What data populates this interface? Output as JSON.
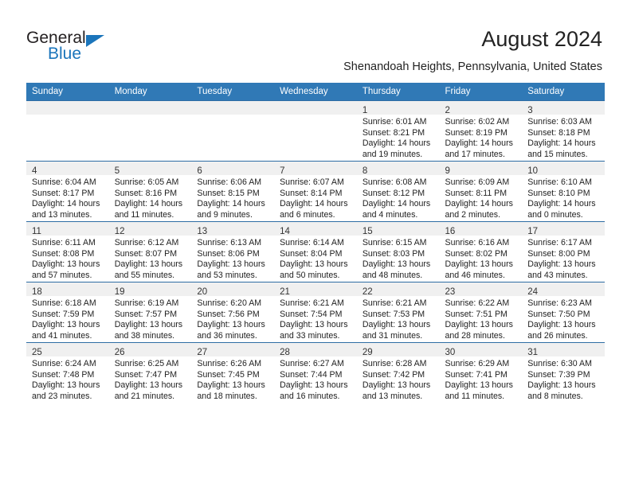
{
  "brand": {
    "name_part1": "General",
    "name_part2": "Blue",
    "triangle_color": "#1b75bb"
  },
  "header": {
    "title": "August 2024",
    "subtitle": "Shenandoah Heights, Pennsylvania, United States"
  },
  "theme": {
    "header_bg": "#3079b6",
    "row_separator": "#2e6da4",
    "daynum_strip_bg": "#f0f0f0",
    "text": "#222222"
  },
  "calendar": {
    "weekday_headers": [
      "Sunday",
      "Monday",
      "Tuesday",
      "Wednesday",
      "Thursday",
      "Friday",
      "Saturday"
    ],
    "weeks": [
      [
        {
          "day": "",
          "empty": true,
          "sunrise": "",
          "sunset": "",
          "daylight_line1": "",
          "daylight_line2": ""
        },
        {
          "day": "",
          "empty": true,
          "sunrise": "",
          "sunset": "",
          "daylight_line1": "",
          "daylight_line2": ""
        },
        {
          "day": "",
          "empty": true,
          "sunrise": "",
          "sunset": "",
          "daylight_line1": "",
          "daylight_line2": ""
        },
        {
          "day": "",
          "empty": true,
          "sunrise": "",
          "sunset": "",
          "daylight_line1": "",
          "daylight_line2": ""
        },
        {
          "day": "1",
          "empty": false,
          "sunrise": "Sunrise: 6:01 AM",
          "sunset": "Sunset: 8:21 PM",
          "daylight_line1": "Daylight: 14 hours",
          "daylight_line2": "and 19 minutes."
        },
        {
          "day": "2",
          "empty": false,
          "sunrise": "Sunrise: 6:02 AM",
          "sunset": "Sunset: 8:19 PM",
          "daylight_line1": "Daylight: 14 hours",
          "daylight_line2": "and 17 minutes."
        },
        {
          "day": "3",
          "empty": false,
          "sunrise": "Sunrise: 6:03 AM",
          "sunset": "Sunset: 8:18 PM",
          "daylight_line1": "Daylight: 14 hours",
          "daylight_line2": "and 15 minutes."
        }
      ],
      [
        {
          "day": "4",
          "empty": false,
          "sunrise": "Sunrise: 6:04 AM",
          "sunset": "Sunset: 8:17 PM",
          "daylight_line1": "Daylight: 14 hours",
          "daylight_line2": "and 13 minutes."
        },
        {
          "day": "5",
          "empty": false,
          "sunrise": "Sunrise: 6:05 AM",
          "sunset": "Sunset: 8:16 PM",
          "daylight_line1": "Daylight: 14 hours",
          "daylight_line2": "and 11 minutes."
        },
        {
          "day": "6",
          "empty": false,
          "sunrise": "Sunrise: 6:06 AM",
          "sunset": "Sunset: 8:15 PM",
          "daylight_line1": "Daylight: 14 hours",
          "daylight_line2": "and 9 minutes."
        },
        {
          "day": "7",
          "empty": false,
          "sunrise": "Sunrise: 6:07 AM",
          "sunset": "Sunset: 8:14 PM",
          "daylight_line1": "Daylight: 14 hours",
          "daylight_line2": "and 6 minutes."
        },
        {
          "day": "8",
          "empty": false,
          "sunrise": "Sunrise: 6:08 AM",
          "sunset": "Sunset: 8:12 PM",
          "daylight_line1": "Daylight: 14 hours",
          "daylight_line2": "and 4 minutes."
        },
        {
          "day": "9",
          "empty": false,
          "sunrise": "Sunrise: 6:09 AM",
          "sunset": "Sunset: 8:11 PM",
          "daylight_line1": "Daylight: 14 hours",
          "daylight_line2": "and 2 minutes."
        },
        {
          "day": "10",
          "empty": false,
          "sunrise": "Sunrise: 6:10 AM",
          "sunset": "Sunset: 8:10 PM",
          "daylight_line1": "Daylight: 14 hours",
          "daylight_line2": "and 0 minutes."
        }
      ],
      [
        {
          "day": "11",
          "empty": false,
          "sunrise": "Sunrise: 6:11 AM",
          "sunset": "Sunset: 8:08 PM",
          "daylight_line1": "Daylight: 13 hours",
          "daylight_line2": "and 57 minutes."
        },
        {
          "day": "12",
          "empty": false,
          "sunrise": "Sunrise: 6:12 AM",
          "sunset": "Sunset: 8:07 PM",
          "daylight_line1": "Daylight: 13 hours",
          "daylight_line2": "and 55 minutes."
        },
        {
          "day": "13",
          "empty": false,
          "sunrise": "Sunrise: 6:13 AM",
          "sunset": "Sunset: 8:06 PM",
          "daylight_line1": "Daylight: 13 hours",
          "daylight_line2": "and 53 minutes."
        },
        {
          "day": "14",
          "empty": false,
          "sunrise": "Sunrise: 6:14 AM",
          "sunset": "Sunset: 8:04 PM",
          "daylight_line1": "Daylight: 13 hours",
          "daylight_line2": "and 50 minutes."
        },
        {
          "day": "15",
          "empty": false,
          "sunrise": "Sunrise: 6:15 AM",
          "sunset": "Sunset: 8:03 PM",
          "daylight_line1": "Daylight: 13 hours",
          "daylight_line2": "and 48 minutes."
        },
        {
          "day": "16",
          "empty": false,
          "sunrise": "Sunrise: 6:16 AM",
          "sunset": "Sunset: 8:02 PM",
          "daylight_line1": "Daylight: 13 hours",
          "daylight_line2": "and 46 minutes."
        },
        {
          "day": "17",
          "empty": false,
          "sunrise": "Sunrise: 6:17 AM",
          "sunset": "Sunset: 8:00 PM",
          "daylight_line1": "Daylight: 13 hours",
          "daylight_line2": "and 43 minutes."
        }
      ],
      [
        {
          "day": "18",
          "empty": false,
          "sunrise": "Sunrise: 6:18 AM",
          "sunset": "Sunset: 7:59 PM",
          "daylight_line1": "Daylight: 13 hours",
          "daylight_line2": "and 41 minutes."
        },
        {
          "day": "19",
          "empty": false,
          "sunrise": "Sunrise: 6:19 AM",
          "sunset": "Sunset: 7:57 PM",
          "daylight_line1": "Daylight: 13 hours",
          "daylight_line2": "and 38 minutes."
        },
        {
          "day": "20",
          "empty": false,
          "sunrise": "Sunrise: 6:20 AM",
          "sunset": "Sunset: 7:56 PM",
          "daylight_line1": "Daylight: 13 hours",
          "daylight_line2": "and 36 minutes."
        },
        {
          "day": "21",
          "empty": false,
          "sunrise": "Sunrise: 6:21 AM",
          "sunset": "Sunset: 7:54 PM",
          "daylight_line1": "Daylight: 13 hours",
          "daylight_line2": "and 33 minutes."
        },
        {
          "day": "22",
          "empty": false,
          "sunrise": "Sunrise: 6:21 AM",
          "sunset": "Sunset: 7:53 PM",
          "daylight_line1": "Daylight: 13 hours",
          "daylight_line2": "and 31 minutes."
        },
        {
          "day": "23",
          "empty": false,
          "sunrise": "Sunrise: 6:22 AM",
          "sunset": "Sunset: 7:51 PM",
          "daylight_line1": "Daylight: 13 hours",
          "daylight_line2": "and 28 minutes."
        },
        {
          "day": "24",
          "empty": false,
          "sunrise": "Sunrise: 6:23 AM",
          "sunset": "Sunset: 7:50 PM",
          "daylight_line1": "Daylight: 13 hours",
          "daylight_line2": "and 26 minutes."
        }
      ],
      [
        {
          "day": "25",
          "empty": false,
          "sunrise": "Sunrise: 6:24 AM",
          "sunset": "Sunset: 7:48 PM",
          "daylight_line1": "Daylight: 13 hours",
          "daylight_line2": "and 23 minutes."
        },
        {
          "day": "26",
          "empty": false,
          "sunrise": "Sunrise: 6:25 AM",
          "sunset": "Sunset: 7:47 PM",
          "daylight_line1": "Daylight: 13 hours",
          "daylight_line2": "and 21 minutes."
        },
        {
          "day": "27",
          "empty": false,
          "sunrise": "Sunrise: 6:26 AM",
          "sunset": "Sunset: 7:45 PM",
          "daylight_line1": "Daylight: 13 hours",
          "daylight_line2": "and 18 minutes."
        },
        {
          "day": "28",
          "empty": false,
          "sunrise": "Sunrise: 6:27 AM",
          "sunset": "Sunset: 7:44 PM",
          "daylight_line1": "Daylight: 13 hours",
          "daylight_line2": "and 16 minutes."
        },
        {
          "day": "29",
          "empty": false,
          "sunrise": "Sunrise: 6:28 AM",
          "sunset": "Sunset: 7:42 PM",
          "daylight_line1": "Daylight: 13 hours",
          "daylight_line2": "and 13 minutes."
        },
        {
          "day": "30",
          "empty": false,
          "sunrise": "Sunrise: 6:29 AM",
          "sunset": "Sunset: 7:41 PM",
          "daylight_line1": "Daylight: 13 hours",
          "daylight_line2": "and 11 minutes."
        },
        {
          "day": "31",
          "empty": false,
          "sunrise": "Sunrise: 6:30 AM",
          "sunset": "Sunset: 7:39 PM",
          "daylight_line1": "Daylight: 13 hours",
          "daylight_line2": "and 8 minutes."
        }
      ]
    ]
  }
}
